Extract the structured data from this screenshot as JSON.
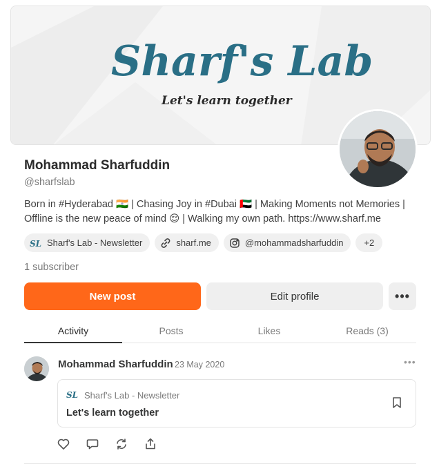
{
  "banner": {
    "title": "Sharf's Lab",
    "tagline": "Let's learn together"
  },
  "profile": {
    "name": "Mohammad Sharfuddin",
    "handle": "@sharfslab",
    "bio": "Born in #Hyderabad 🇮🇳 | Chasing Joy in #Dubai 🇦🇪 | Making Moments not Memories | Offline is the new peace of mind 😌 | Walking my own path. https://www.sharf.me",
    "subscribers": "1 subscriber"
  },
  "chips": {
    "newsletter": "Sharf's Lab - Newsletter",
    "website": "sharf.me",
    "instagram": "@mohammadsharfuddin",
    "more": "+2"
  },
  "buttons": {
    "new_post": "New post",
    "edit_profile": "Edit profile",
    "more": "•••"
  },
  "tabs": {
    "activity": "Activity",
    "posts": "Posts",
    "likes": "Likes",
    "reads": "Reads (3)"
  },
  "post": {
    "author": "Mohammad Sharfuddin",
    "date": "23 May 2020",
    "menu": "•••",
    "publication": "Sharf's Lab - Newsletter",
    "title": "Let's learn together"
  },
  "colors": {
    "accent": "#ff6719",
    "logo_teal": "#2a6f86",
    "logo_dark": "#2b2b2b"
  }
}
